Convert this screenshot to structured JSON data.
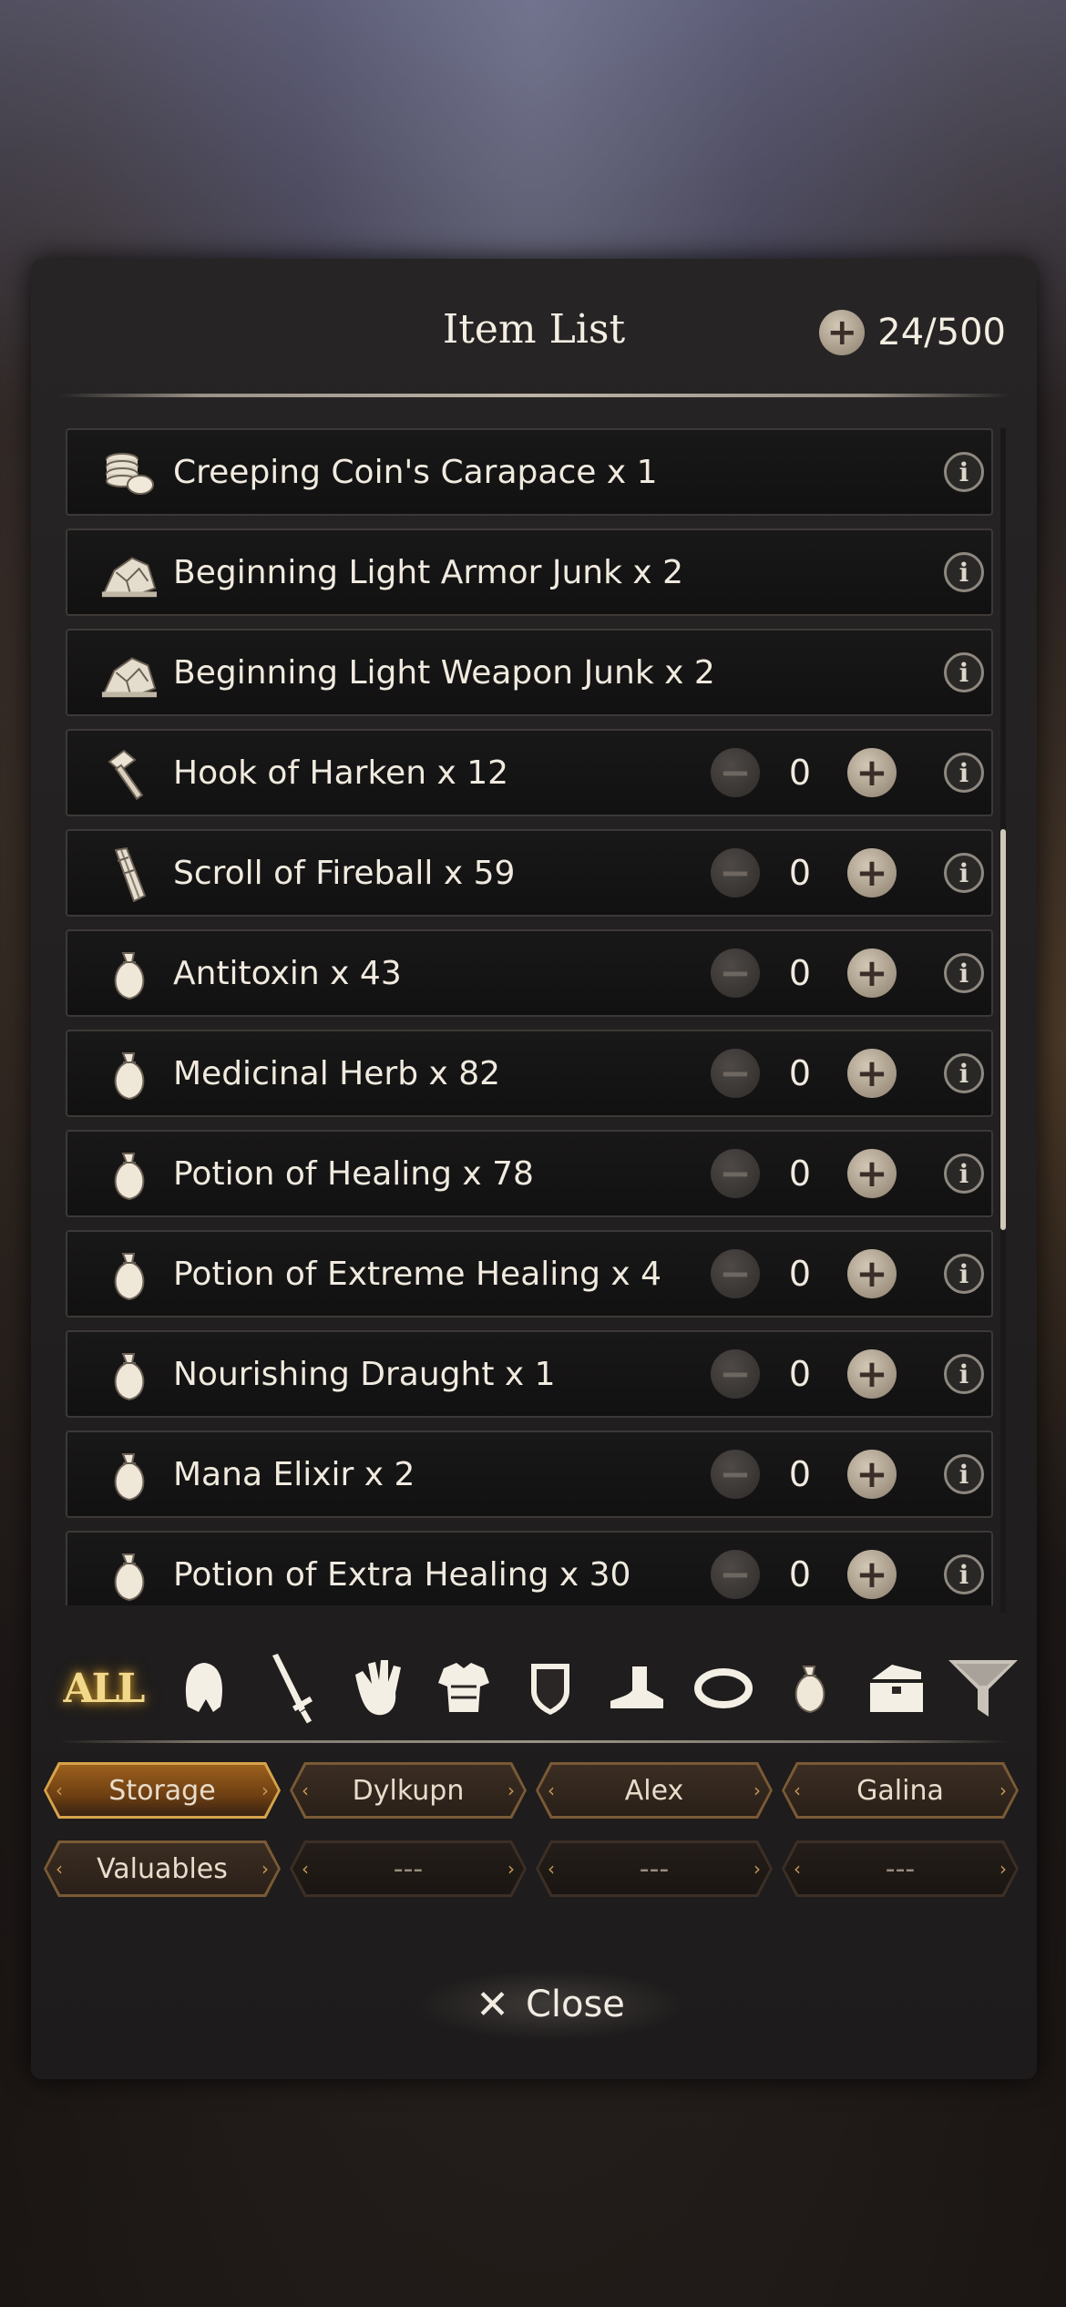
{
  "header": {
    "title": "Item List",
    "capacity": "24/500"
  },
  "items": [
    {
      "name": "Creeping Coin's Carapace x 1",
      "icon": "coins-icon",
      "qty": null
    },
    {
      "name": "Beginning Light Armor Junk x 2",
      "icon": "junk-icon",
      "qty": null
    },
    {
      "name": "Beginning Light Weapon Junk x 2",
      "icon": "junk-icon",
      "qty": null
    },
    {
      "name": "Hook of Harken x 12",
      "icon": "hammer-icon",
      "qty": "0"
    },
    {
      "name": "Scroll of Fireball x 59",
      "icon": "scroll-icon",
      "qty": "0"
    },
    {
      "name": "Antitoxin x 43",
      "icon": "pouch-icon",
      "qty": "0"
    },
    {
      "name": "Medicinal Herb x 82",
      "icon": "pouch-icon",
      "qty": "0"
    },
    {
      "name": "Potion of Healing x 78",
      "icon": "pouch-icon",
      "qty": "0"
    },
    {
      "name": "Potion of Extreme Healing x 4",
      "icon": "pouch-icon",
      "qty": "0"
    },
    {
      "name": "Nourishing Draught x 1",
      "icon": "pouch-icon",
      "qty": "0"
    },
    {
      "name": "Mana Elixir x 2",
      "icon": "pouch-icon",
      "qty": "0"
    },
    {
      "name": "Potion of Extra Healing x 30",
      "icon": "pouch-icon",
      "qty": "0"
    }
  ],
  "filters": {
    "all_label": "ALL",
    "icons": [
      "helmet-icon",
      "sword-icon",
      "glove-icon",
      "armor-icon",
      "shield-icon",
      "boot-icon",
      "ring-icon",
      "pouch-icon",
      "chest-icon",
      "funnel-icon"
    ]
  },
  "tabs": [
    {
      "label": "Storage",
      "state": "active"
    },
    {
      "label": "Dylkupn",
      "state": "normal"
    },
    {
      "label": "Alex",
      "state": "normal"
    },
    {
      "label": "Galina",
      "state": "normal"
    },
    {
      "label": "Valuables",
      "state": "normal"
    },
    {
      "label": "---",
      "state": "empty"
    },
    {
      "label": "---",
      "state": "empty"
    },
    {
      "label": "---",
      "state": "empty"
    }
  ],
  "close_label": "Close",
  "colors": {
    "panel": "#1f1d1d",
    "accent_gold": "#d7a24a",
    "text": "#f0eadf"
  }
}
